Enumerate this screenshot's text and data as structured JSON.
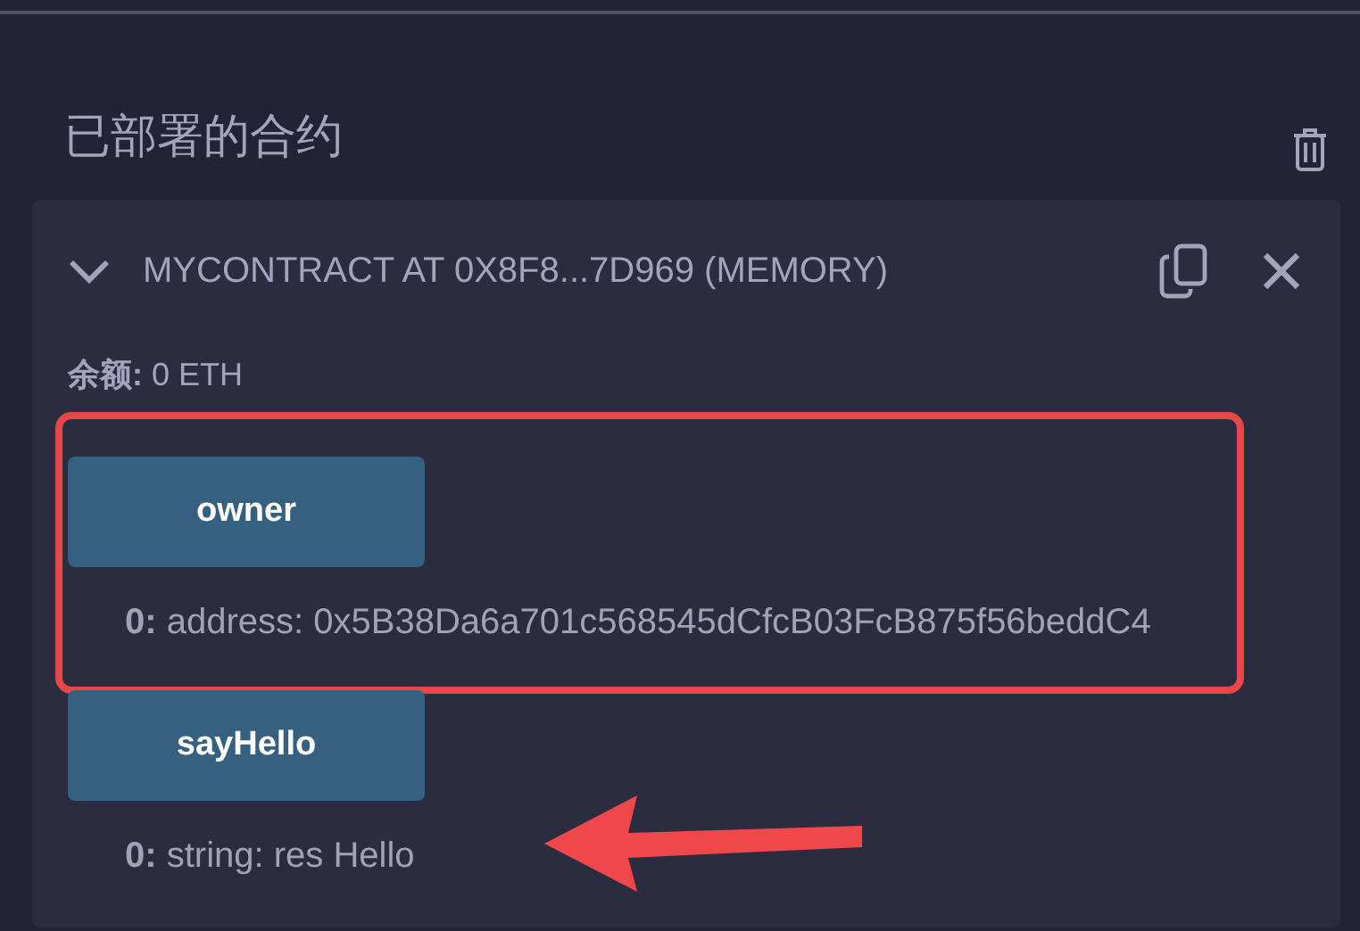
{
  "header": {
    "title": "已部署的合约"
  },
  "contract": {
    "expanded": true,
    "title": "MYCONTRACT AT 0X8F8...7D969 (MEMORY)",
    "balance": "**余额:** 0 ETH",
    "functions": [
      {
        "name": "owner",
        "boxed": true,
        "arrow": false,
        "outputs": [
          "**0:**  address: 0x5B38Da6a701c568545dCfcB03FcB875f56beddC4"
        ]
      },
      {
        "name": "sayHello",
        "boxed": false,
        "arrow": true,
        "outputs": [
          "**0:**  string: res Hello"
        ]
      }
    ]
  }
}
